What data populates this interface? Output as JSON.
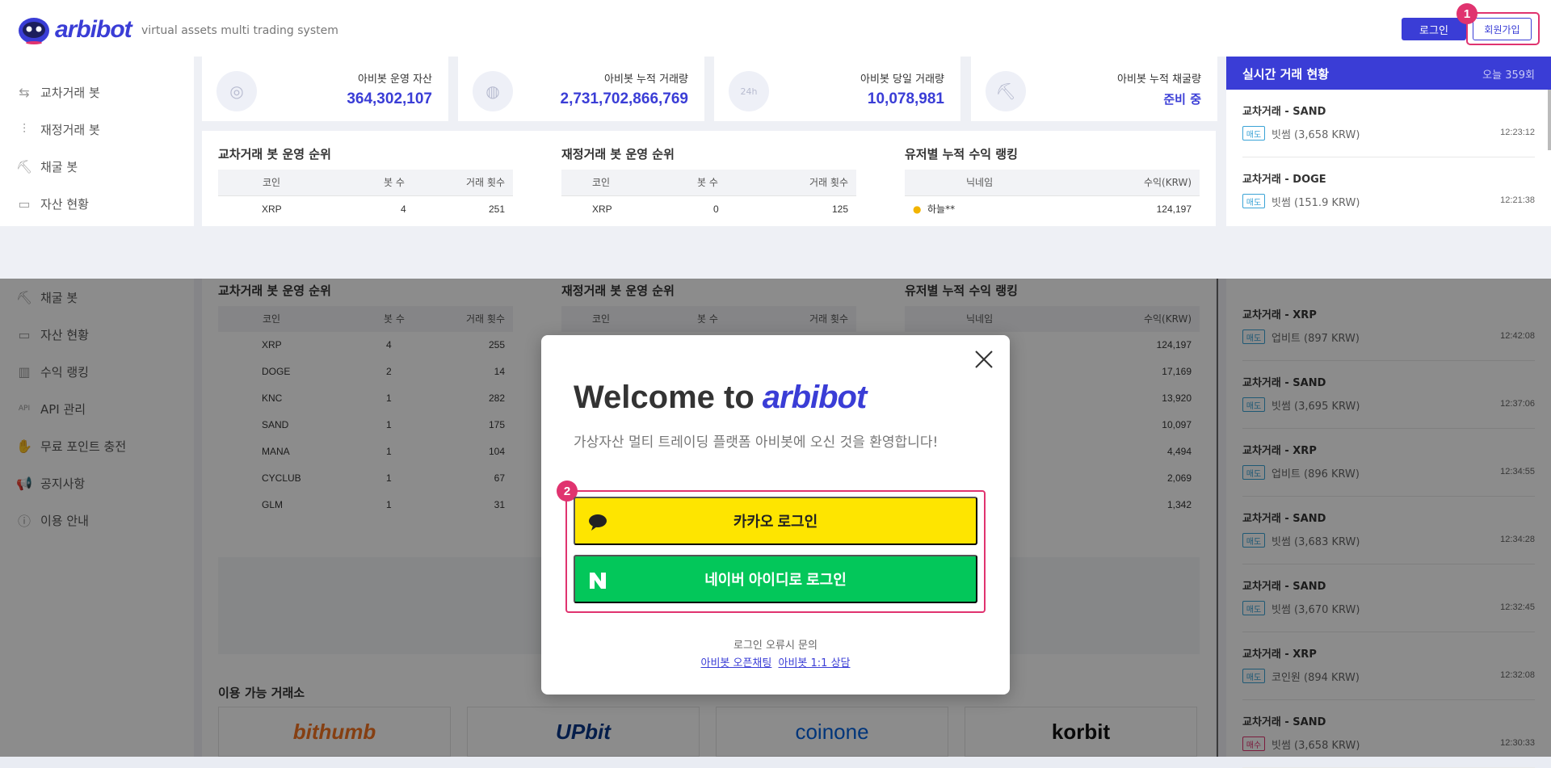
{
  "brand": {
    "name": "arbibot",
    "tagline": "virtual assets multi trading system"
  },
  "header": {
    "login_label": "로그인",
    "signup_label": "회원가입",
    "step1_badge": "1"
  },
  "sidebar": {
    "items": [
      {
        "label": "교차거래 봇",
        "icon": "exchange-arrows-icon"
      },
      {
        "label": "재정거래 봇",
        "icon": "candlestick-icon"
      },
      {
        "label": "채굴 봇",
        "icon": "pickaxe-icon"
      },
      {
        "label": "자산 현황",
        "icon": "wallet-icon"
      }
    ]
  },
  "stats": [
    {
      "label": "아비봇 운영 자산",
      "value": "364,302,107",
      "icon": "coins-icon"
    },
    {
      "label": "아비봇 누적 거래량",
      "value": "2,731,702,866,769",
      "icon": "money-bag-icon"
    },
    {
      "label": "아비봇 당일 거래량",
      "value": "10,078,981",
      "icon": "24h-icon"
    },
    {
      "label": "아비봇 누적 채굴량",
      "value": "준비 중",
      "icon": "pickaxe-icon"
    }
  ],
  "rankings": {
    "cross": {
      "title": "교차거래 봇 운영 순위",
      "headers": [
        "코인",
        "봇 수",
        "거래 횟수"
      ],
      "row": [
        "XRP",
        "4",
        "251"
      ]
    },
    "arb": {
      "title": "재정거래 봇 운영 순위",
      "headers": [
        "코인",
        "봇 수",
        "거래 횟수"
      ],
      "row": [
        "XRP",
        "0",
        "125"
      ]
    },
    "user": {
      "title": "유저별 누적 수익 랭킹",
      "headers": [
        "닉네임",
        "수익(KRW)"
      ],
      "row": [
        "하늘**",
        "124,197"
      ]
    }
  },
  "live": {
    "title": "실시간 거래 현황",
    "count": "오늘 359회",
    "trades": [
      {
        "title": "교차거래 - SAND",
        "tag": "매도",
        "exchange": "빗썸 (3,658 KRW)",
        "time": "12:23:12"
      },
      {
        "title": "교차거래 - DOGE",
        "tag": "매도",
        "exchange": "빗썸 (151.9 KRW)",
        "time": "12:21:38"
      }
    ]
  },
  "lower": {
    "sidebar_items": [
      {
        "label": "채굴 봇",
        "icon": "pickaxe-icon"
      },
      {
        "label": "자산 현황",
        "icon": "wallet-icon"
      },
      {
        "label": "수익 랭킹",
        "icon": "bar-chart-icon"
      },
      {
        "label": "API 관리",
        "icon": "api-icon"
      },
      {
        "label": "무료 포인트 충전",
        "icon": "coin-hand-icon"
      },
      {
        "label": "공지사항",
        "icon": "megaphone-icon"
      },
      {
        "label": "이용 안내",
        "icon": "info-icon"
      }
    ],
    "cross": {
      "title": "교차거래 봇 운영 순위",
      "headers": [
        "코인",
        "봇 수",
        "거래 횟수"
      ],
      "rows": [
        [
          "XRP",
          "4",
          "255"
        ],
        [
          "DOGE",
          "2",
          "14"
        ],
        [
          "KNC",
          "1",
          "282"
        ],
        [
          "SAND",
          "1",
          "175"
        ],
        [
          "MANA",
          "1",
          "104"
        ],
        [
          "CYCLUB",
          "1",
          "67"
        ],
        [
          "GLM",
          "1",
          "31"
        ]
      ]
    },
    "arb": {
      "title": "재정거래 봇 운영 순위",
      "headers": [
        "코인",
        "봇 수",
        "거래 횟수"
      ]
    },
    "user": {
      "title": "유저별 누적 수익 랭킹",
      "headers": [
        "닉네임",
        "수익(KRW)"
      ],
      "values": [
        "124,197",
        "17,169",
        "13,920",
        "10,097",
        "4,494",
        "2,069",
        "1,342"
      ]
    },
    "exchanges_title": "이용 가능 거래소",
    "exchanges": [
      "bithumb",
      "UPbit",
      "coinone",
      "korbit"
    ],
    "trades": [
      {
        "title": "교차거래 - XRP",
        "tag": "매도",
        "exchange": "업비트 (897 KRW)",
        "time": "12:42:08"
      },
      {
        "title": "교차거래 - SAND",
        "tag": "매도",
        "exchange": "빗썸 (3,695 KRW)",
        "time": "12:37:06"
      },
      {
        "title": "교차거래 - XRP",
        "tag": "매도",
        "exchange": "업비트 (896 KRW)",
        "time": "12:34:55"
      },
      {
        "title": "교차거래 - SAND",
        "tag": "매도",
        "exchange": "빗썸 (3,683 KRW)",
        "time": "12:34:28"
      },
      {
        "title": "교차거래 - SAND",
        "tag": "매도",
        "exchange": "빗썸 (3,670 KRW)",
        "time": "12:32:45"
      },
      {
        "title": "교차거래 - XRP",
        "tag": "매도",
        "exchange": "코인원 (894 KRW)",
        "time": "12:32:08"
      },
      {
        "title": "교차거래 - SAND",
        "tag": "매수",
        "exchange": "빗썸 (3,658 KRW)",
        "time": "12:30:33"
      }
    ]
  },
  "modal": {
    "welcome": "Welcome to",
    "brand": "arbibot",
    "subtitle": "가상자산 멀티 트레이딩 플랫폼 아비봇에 오신 것을 환영합니다!",
    "kakao_label": "카카오 로그인",
    "naver_label": "네이버 아이디로 로그인",
    "error_text": "로그인 오류시 문의",
    "link_openchat": "아비봇 오픈채팅",
    "link_consult": "아비봇 1:1 상담",
    "step2_badge": "2"
  },
  "colors": {
    "accent": "#3a3dd6",
    "highlight": "#e0336f",
    "kakao": "#fee500",
    "naver": "#03c75a"
  }
}
